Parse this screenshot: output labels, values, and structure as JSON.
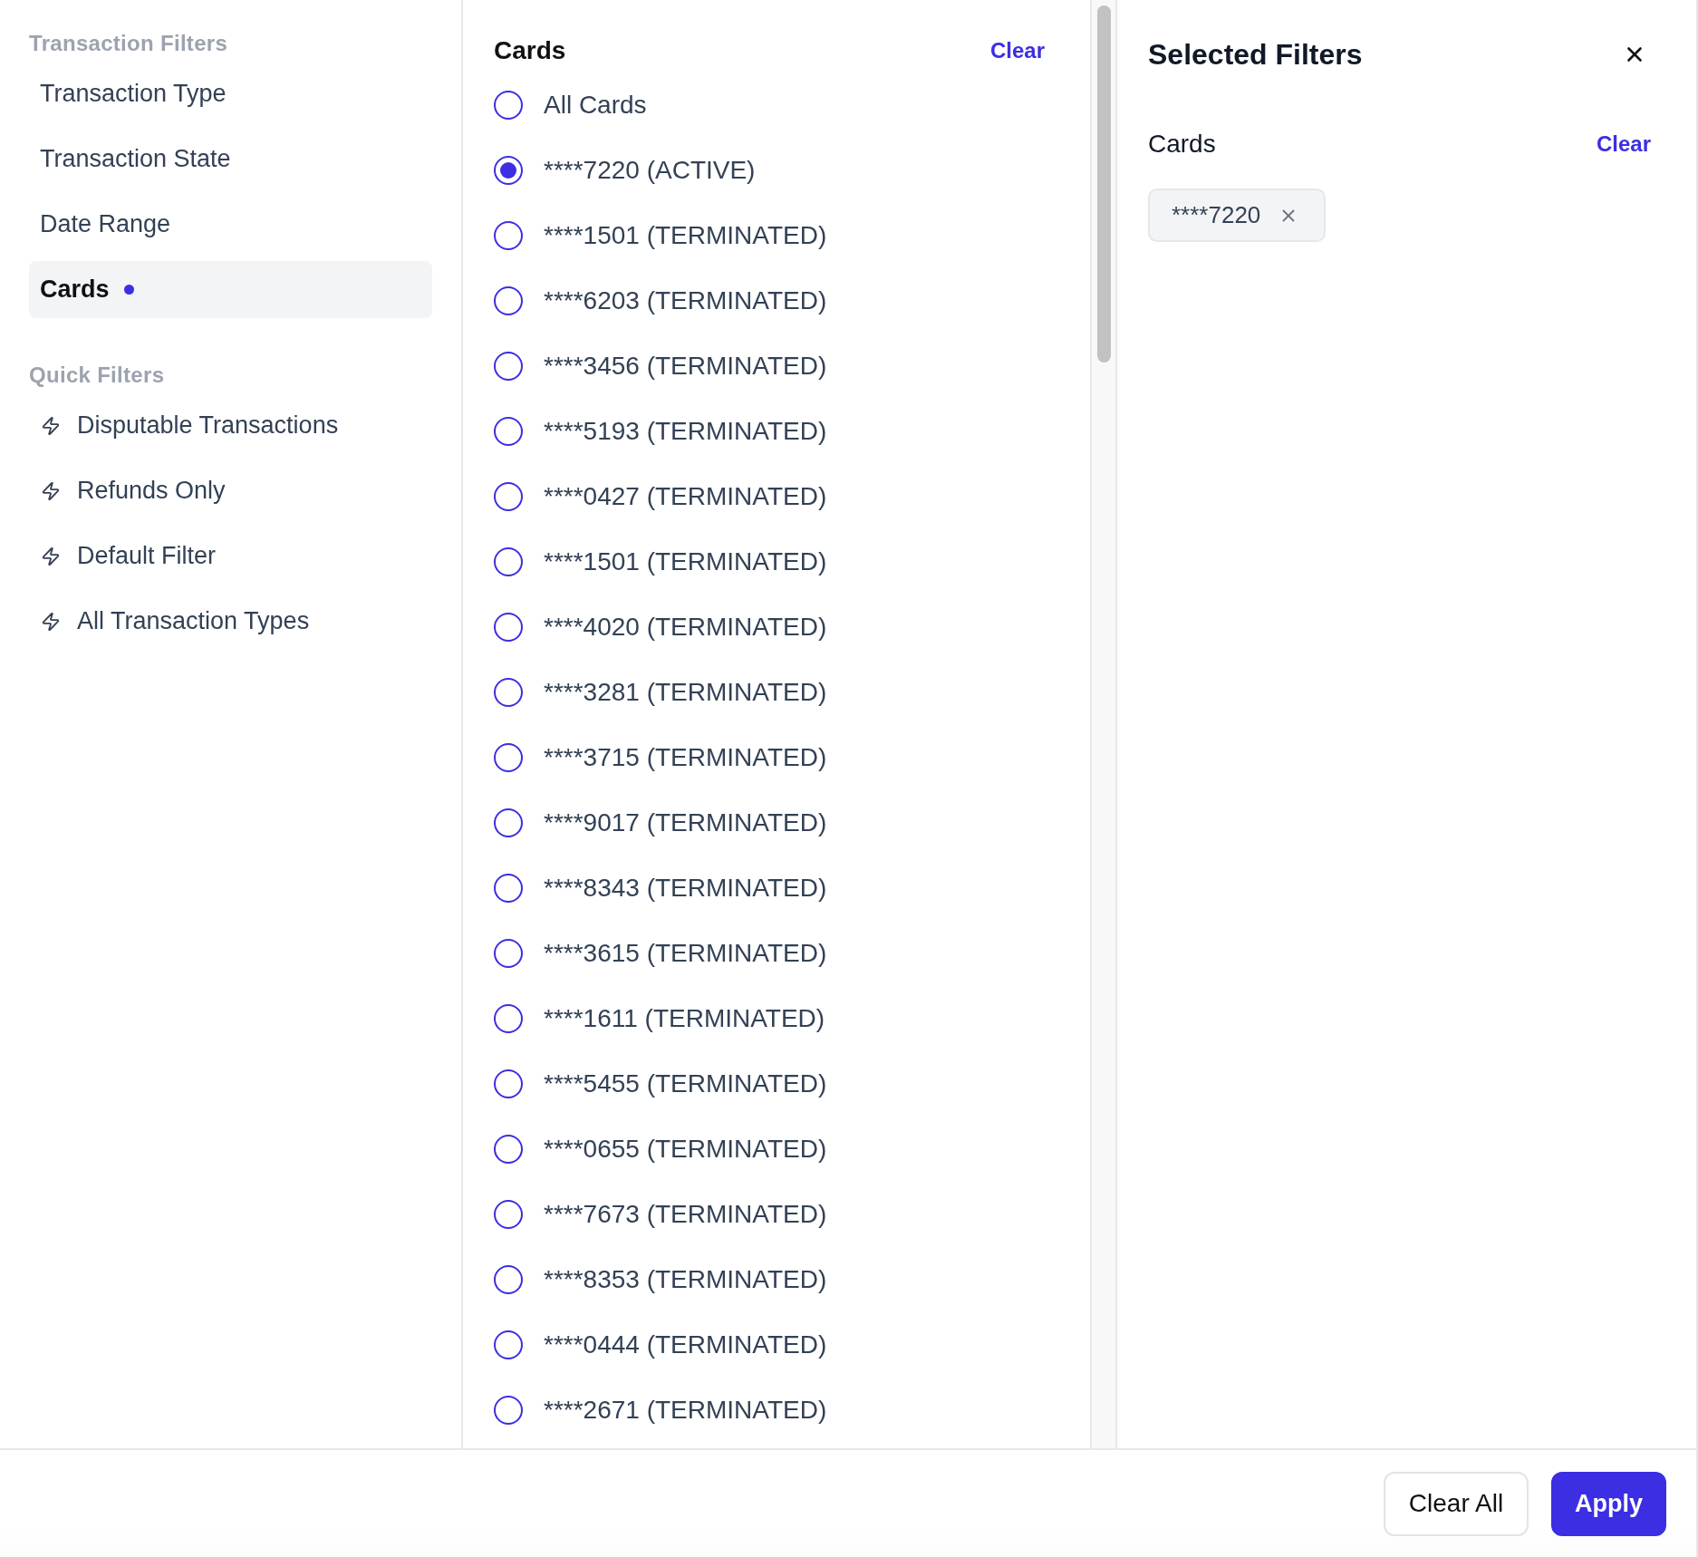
{
  "sidebar": {
    "sections": [
      {
        "kind": "filters",
        "title": "Transaction Filters",
        "items": [
          {
            "label": "Transaction Type",
            "selected": false,
            "applied": false
          },
          {
            "label": "Transaction State",
            "selected": false,
            "applied": false
          },
          {
            "label": "Date Range",
            "selected": false,
            "applied": false
          },
          {
            "label": "Cards",
            "selected": true,
            "applied": true
          }
        ]
      },
      {
        "kind": "quick",
        "title": "Quick Filters",
        "items": [
          {
            "label": "Disputable Transactions"
          },
          {
            "label": "Refunds Only"
          },
          {
            "label": "Default Filter"
          },
          {
            "label": "All Transaction Types"
          }
        ]
      }
    ]
  },
  "card_panel": {
    "title": "Cards",
    "clear": "Clear",
    "options": [
      {
        "label": "All Cards",
        "selected": false
      },
      {
        "label": "****7220 (ACTIVE)",
        "selected": true
      },
      {
        "label": "****1501 (TERMINATED)",
        "selected": false
      },
      {
        "label": "****6203 (TERMINATED)",
        "selected": false
      },
      {
        "label": "****3456 (TERMINATED)",
        "selected": false
      },
      {
        "label": "****5193 (TERMINATED)",
        "selected": false
      },
      {
        "label": "****0427 (TERMINATED)",
        "selected": false
      },
      {
        "label": "****1501 (TERMINATED)",
        "selected": false
      },
      {
        "label": "****4020 (TERMINATED)",
        "selected": false
      },
      {
        "label": "****3281 (TERMINATED)",
        "selected": false
      },
      {
        "label": "****3715 (TERMINATED)",
        "selected": false
      },
      {
        "label": "****9017 (TERMINATED)",
        "selected": false
      },
      {
        "label": "****8343 (TERMINATED)",
        "selected": false
      },
      {
        "label": "****3615 (TERMINATED)",
        "selected": false
      },
      {
        "label": "****1611 (TERMINATED)",
        "selected": false
      },
      {
        "label": "****5455 (TERMINATED)",
        "selected": false
      },
      {
        "label": "****0655 (TERMINATED)",
        "selected": false
      },
      {
        "label": "****7673 (TERMINATED)",
        "selected": false
      },
      {
        "label": "****8353 (TERMINATED)",
        "selected": false
      },
      {
        "label": "****0444 (TERMINATED)",
        "selected": false
      },
      {
        "label": "****2671 (TERMINATED)",
        "selected": false
      }
    ]
  },
  "selected_panel": {
    "title": "Selected Filters",
    "groups": [
      {
        "title": "Cards",
        "clear": "Clear",
        "chips": [
          {
            "label": "****7220"
          }
        ]
      }
    ]
  },
  "footer": {
    "buttons": [
      {
        "label": "Clear All",
        "kind": "secondary"
      },
      {
        "label": "Apply",
        "kind": "primary"
      }
    ]
  }
}
